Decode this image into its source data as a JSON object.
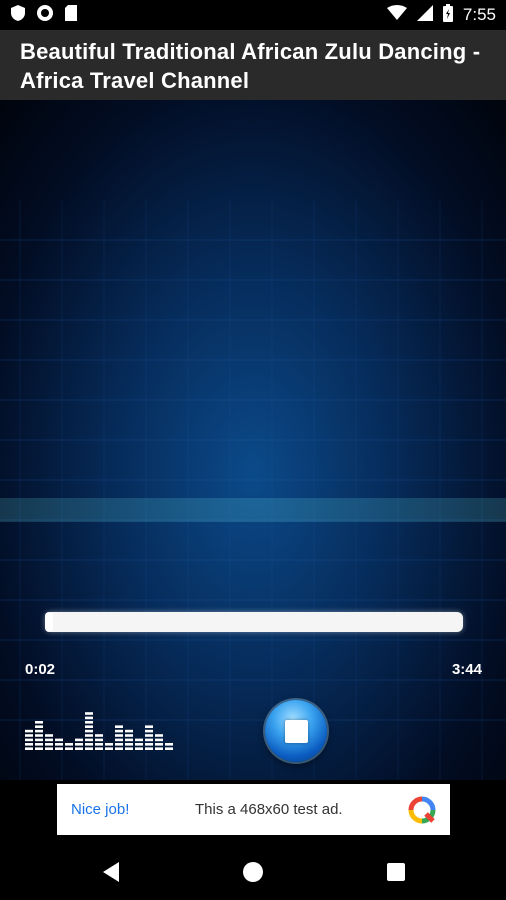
{
  "status_bar": {
    "time": "7:55",
    "icons_left": [
      "shield-icon",
      "record-icon",
      "sd-card-icon"
    ],
    "icons_right": [
      "wifi-icon",
      "signal-icon",
      "battery-icon"
    ]
  },
  "header": {
    "title": "Beautiful Traditional African Zulu Dancing - Africa Travel Channel"
  },
  "player": {
    "current_time": "0:02",
    "total_time": "3:44",
    "progress_fraction": 0.01,
    "control_icon": "stop-icon",
    "equalizer_icon": "equalizer-icon"
  },
  "ad": {
    "cta": "Nice job!",
    "text": "This a 468x60 test ad.",
    "logo_icon": "ad-logo-icon"
  },
  "nav": {
    "icons": [
      "back-icon",
      "home-icon",
      "recents-icon"
    ]
  },
  "colors": {
    "title_bar": "#2a2a2a",
    "accent_blue": "#1a73e8",
    "wave_cyan": "#3fd3e8"
  }
}
